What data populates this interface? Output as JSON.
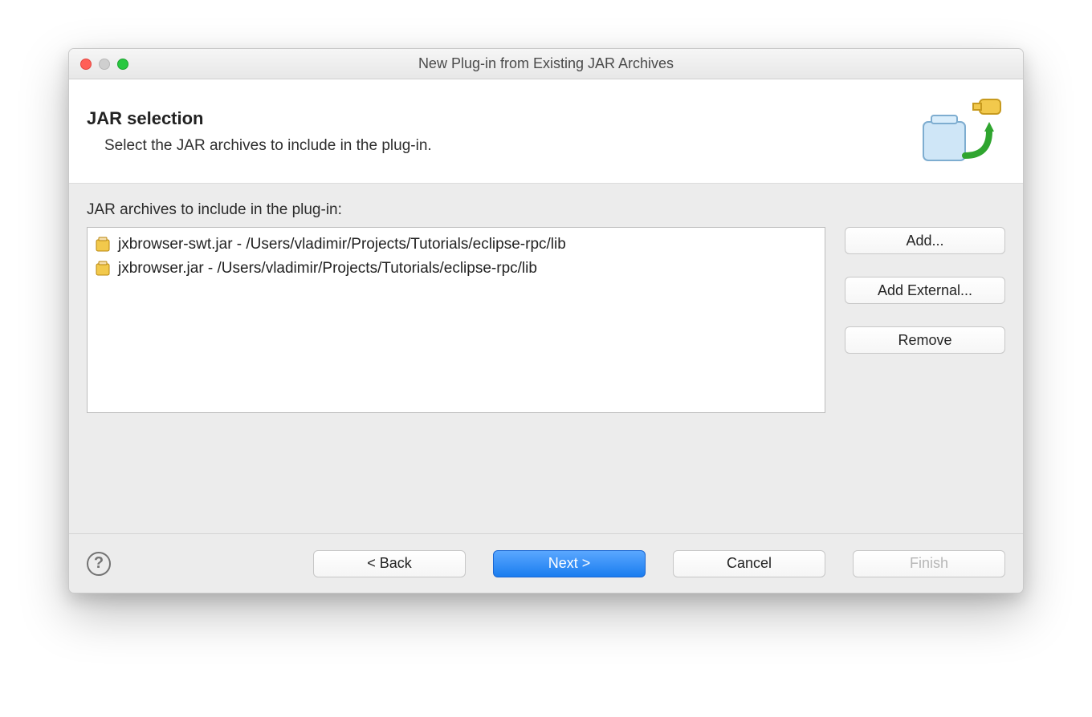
{
  "window": {
    "title": "New Plug-in from Existing JAR Archives"
  },
  "banner": {
    "title": "JAR selection",
    "description": "Select the JAR archives to include in the plug-in."
  },
  "content": {
    "list_label": "JAR archives to include in the plug-in:",
    "jars": [
      "jxbrowser-swt.jar - /Users/vladimir/Projects/Tutorials/eclipse-rpc/lib",
      "jxbrowser.jar - /Users/vladimir/Projects/Tutorials/eclipse-rpc/lib"
    ],
    "buttons": {
      "add": "Add...",
      "add_external": "Add External...",
      "remove": "Remove"
    }
  },
  "footer": {
    "back": "< Back",
    "next": "Next >",
    "cancel": "Cancel",
    "finish": "Finish"
  }
}
